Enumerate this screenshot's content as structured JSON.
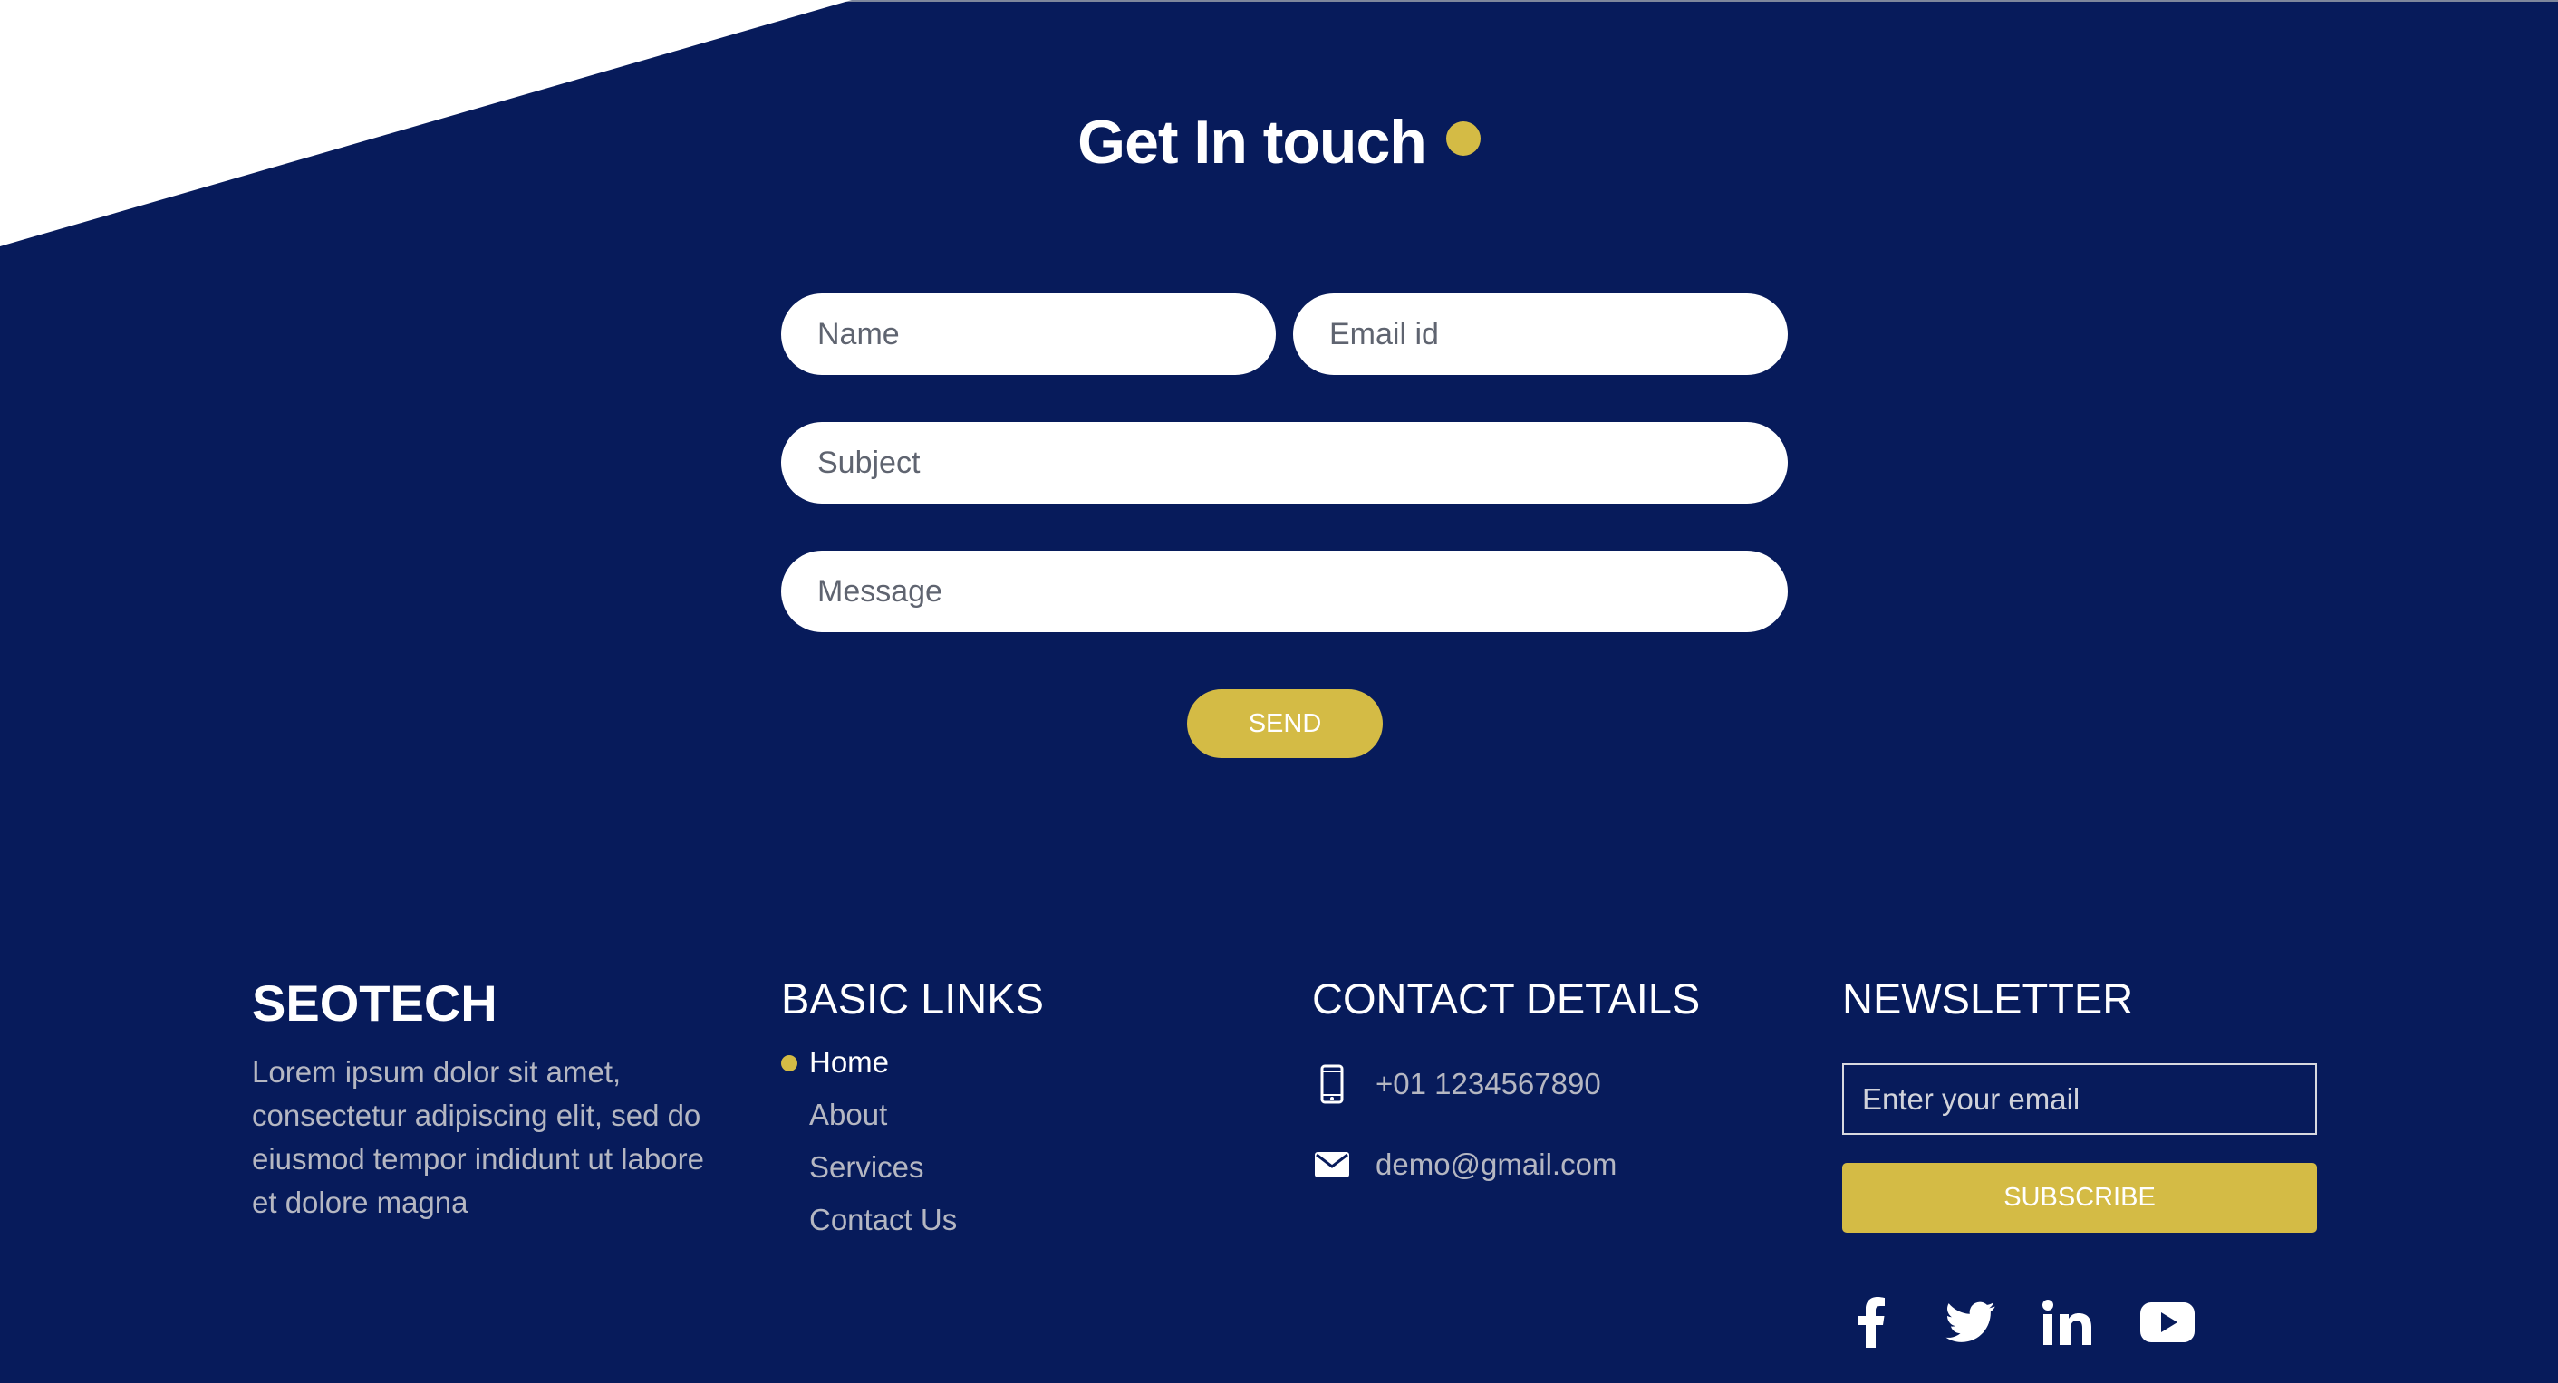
{
  "contact_form": {
    "title": "Get In touch",
    "name_placeholder": "Name",
    "email_placeholder": "Email id",
    "subject_placeholder": "Subject",
    "message_placeholder": "Message",
    "send_label": "SEND"
  },
  "footer": {
    "brand": "SEOTECH",
    "about_text": "Lorem ipsum dolor sit amet, consectetur adipiscing elit, sed do eiusmod tempor indidunt ut labore et dolore magna",
    "basic_links": {
      "title": "BASIC LINKS",
      "items": [
        {
          "label": "Home",
          "active": true
        },
        {
          "label": "About"
        },
        {
          "label": "Services"
        },
        {
          "label": "Contact Us"
        }
      ]
    },
    "contact_details": {
      "title": "CONTACT DETAILS",
      "phone": "+01 1234567890",
      "phone_icon": "mobile-phone-icon",
      "email": "demo@gmail.com",
      "email_icon": "envelope-icon"
    },
    "newsletter": {
      "title": "NEWSLETTER",
      "email_placeholder": "Enter your email",
      "subscribe_label": "SUBSCRIBE"
    },
    "social_icons": [
      "facebook-icon",
      "twitter-icon",
      "linkedin-icon",
      "youtube-icon"
    ]
  },
  "colors": {
    "background": "#071b5b",
    "accent": "#d4bb45",
    "text_muted": "#b5b7c2",
    "white": "#ffffff"
  }
}
